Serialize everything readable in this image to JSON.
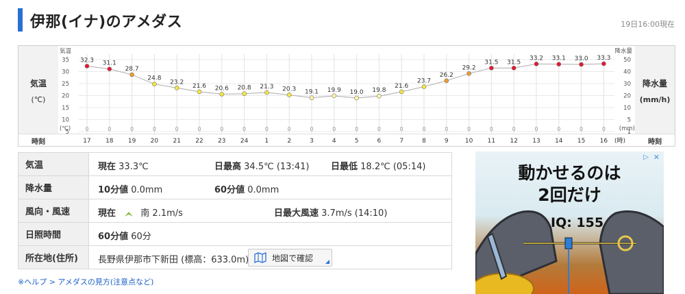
{
  "header": {
    "title": "伊那(イナ)のアメダス",
    "as_of": "19日16:00現在"
  },
  "chart": {
    "left_label_line1": "気温",
    "left_label_line2": "(℃)",
    "right_label_line1": "降水量",
    "right_label_line2": "(mm/h)",
    "time_label": "時刻",
    "left_axis_title": "気温",
    "left_axis_unit": "(℃)",
    "right_axis_title": "降水量",
    "right_axis_unit": "(mm)",
    "hour_unit": "(時)"
  },
  "chart_data": {
    "type": "line",
    "x": [
      "17",
      "18",
      "19",
      "20",
      "21",
      "22",
      "23",
      "24",
      "1",
      "2",
      "3",
      "4",
      "5",
      "6",
      "7",
      "8",
      "9",
      "10",
      "11",
      "12",
      "13",
      "14",
      "15",
      "16"
    ],
    "temperature": [
      32.3,
      31.1,
      28.7,
      24.8,
      23.2,
      21.6,
      20.6,
      20.8,
      21.3,
      20.3,
      19.1,
      19.9,
      19.0,
      19.8,
      21.6,
      23.7,
      26.2,
      29.2,
      31.5,
      31.5,
      33.2,
      33.1,
      33.0,
      33.3
    ],
    "precipitation": [
      0,
      0,
      0,
      0,
      0,
      0,
      0,
      0,
      0,
      0,
      0,
      0,
      0,
      0,
      0,
      0,
      0,
      0,
      0,
      0,
      0,
      0,
      0,
      0
    ],
    "left_ticks": [
      "35",
      "30",
      "25",
      "20",
      "15",
      "10",
      "5"
    ],
    "right_ticks": [
      "50",
      "40",
      "30",
      "20",
      "10",
      "5",
      "1"
    ],
    "ylim_temp": [
      0,
      35
    ],
    "colors": {
      "hot": "#e8162e",
      "warm": "#f09a2a",
      "mild": "#f5e83a",
      "cool": "#fff6a8",
      "line": "#aaaaaa"
    }
  },
  "table": {
    "temp": {
      "head": "気温",
      "now_label": "現在",
      "now_value": "33.3℃",
      "max_label": "日最高",
      "max_value": "34.5℃ (13:41)",
      "min_label": "日最低",
      "min_value": "18.2℃ (05:14)"
    },
    "precip": {
      "head": "降水量",
      "ten_label": "10分値",
      "ten_value": "0.0mm",
      "sixty_label": "60分値",
      "sixty_value": "0.0mm"
    },
    "wind": {
      "head": "風向・風速",
      "now_label": "現在",
      "arrow_icon": "wind-direction-icon",
      "now_value": "南 2.1m/s",
      "max_label": "日最大風速",
      "max_value": "3.7m/s (14:10)"
    },
    "sun": {
      "head": "日照時間",
      "sixty_label": "60分値",
      "sixty_value": "60分"
    },
    "location": {
      "head": "所在地(住所)",
      "address": "長野県伊那市下新田 (標高：633.0m)",
      "map_button": "地図で確認"
    }
  },
  "help_link": "※ヘルプ > アメダスの見方(注意点など)",
  "ad": {
    "line1": "動かせるのは",
    "line2": "2回だけ",
    "iq": "IQ: 155",
    "info_icon": "ad-info-icon"
  }
}
